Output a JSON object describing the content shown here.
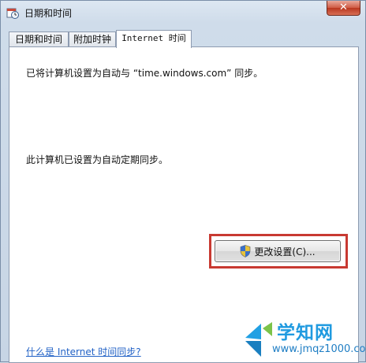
{
  "window": {
    "title": "日期和时间",
    "close_label": "✕"
  },
  "tabs": [
    {
      "label": "日期和时间",
      "active": false
    },
    {
      "label": "附加时钟",
      "active": false
    },
    {
      "label": "Internet 时间",
      "active": true
    }
  ],
  "panel": {
    "sync_message": "已将计算机设置为自动与 “time.windows.com” 同步。",
    "auto_sync_status": "此计算机已设置为自动定期同步。",
    "change_settings_label": "更改设置(C)...",
    "help_link": "什么是 Internet 时间同步?"
  },
  "watermark": {
    "text": "学知网",
    "url": "www.jmqz1000.com"
  },
  "colors": {
    "highlight": "#c83a32",
    "link": "#2262c6",
    "watermark": "#1f9ae0"
  }
}
